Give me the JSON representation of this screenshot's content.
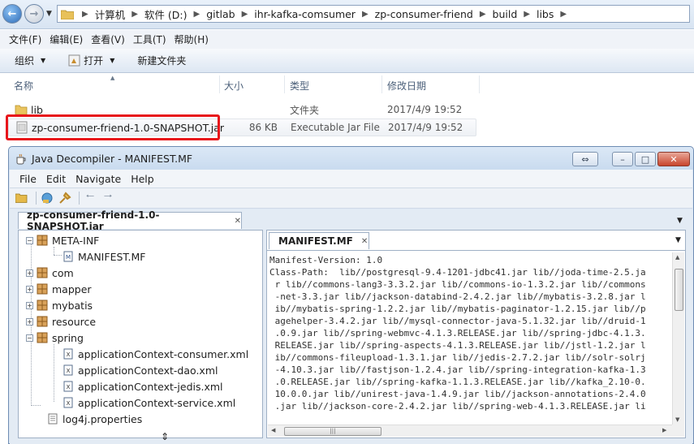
{
  "explorer": {
    "breadcrumbs": [
      "计算机",
      "软件 (D:)",
      "gitlab",
      "ihr-kafka-comsumer",
      "zp-consumer-friend",
      "build",
      "libs"
    ],
    "menu": [
      "文件(F)",
      "编辑(E)",
      "查看(V)",
      "工具(T)",
      "帮助(H)"
    ],
    "toolbar": {
      "organize": "组织",
      "open": "打开",
      "new_folder": "新建文件夹"
    },
    "columns": {
      "name": "名称",
      "size": "大小",
      "type": "类型",
      "modified": "修改日期"
    },
    "files": [
      {
        "name": "lib",
        "size": "",
        "type": "文件夹",
        "modified": "2017/4/9 19:52",
        "icon": "folder-icon"
      },
      {
        "name": "zp-consumer-friend-1.0-SNAPSHOT.jar",
        "size": "86 KB",
        "type": "Executable Jar File",
        "modified": "2017/4/9 19:52",
        "icon": "jar-file-icon"
      }
    ]
  },
  "decompiler": {
    "title": "Java Decompiler - MANIFEST.MF",
    "menu": [
      "File",
      "Edit",
      "Navigate",
      "Help"
    ],
    "jar_tab": "zp-consumer-friend-1.0-SNAPSHOT.jar",
    "file_tab": "MANIFEST.MF",
    "tree": [
      {
        "label": "META-INF",
        "kind": "package"
      },
      {
        "label": "MANIFEST.MF",
        "kind": "manifest"
      },
      {
        "label": "com",
        "kind": "package"
      },
      {
        "label": "mapper",
        "kind": "package"
      },
      {
        "label": "mybatis",
        "kind": "package"
      },
      {
        "label": "resource",
        "kind": "package"
      },
      {
        "label": "spring",
        "kind": "package"
      },
      {
        "label": "applicationContext-consumer.xml",
        "kind": "xml"
      },
      {
        "label": "applicationContext-dao.xml",
        "kind": "xml"
      },
      {
        "label": "applicationContext-jedis.xml",
        "kind": "xml"
      },
      {
        "label": "applicationContext-service.xml",
        "kind": "xml"
      },
      {
        "label": "log4j.properties",
        "kind": "file"
      }
    ],
    "code_lines": [
      "Manifest-Version: 1.0",
      "Class-Path:  lib//postgresql-9.4-1201-jdbc41.jar lib//joda-time-2.5.ja",
      " r lib//commons-lang3-3.3.2.jar lib//commons-io-1.3.2.jar lib//commons",
      " -net-3.3.jar lib//jackson-databind-2.4.2.jar lib//mybatis-3.2.8.jar l",
      " ib//mybatis-spring-1.2.2.jar lib//mybatis-paginator-1.2.15.jar lib//p",
      " agehelper-3.4.2.jar lib//mysql-connector-java-5.1.32.jar lib//druid-1",
      " .0.9.jar lib//spring-webmvc-4.1.3.RELEASE.jar lib//spring-jdbc-4.1.3.",
      " RELEASE.jar lib//spring-aspects-4.1.3.RELEASE.jar lib//jstl-1.2.jar l",
      " ib//commons-fileupload-1.3.1.jar lib//jedis-2.7.2.jar lib//solr-solrj",
      " -4.10.3.jar lib//fastjson-1.2.4.jar lib//spring-integration-kafka-1.3",
      " .0.RELEASE.jar lib//spring-kafka-1.1.3.RELEASE.jar lib//kafka_2.10-0.",
      " 10.0.0.jar lib//unirest-java-1.4.9.jar lib//jackson-annotations-2.4.0",
      " .jar lib//jackson-core-2.4.2.jar lib//spring-web-4.1.3.RELEASE.jar li"
    ]
  }
}
